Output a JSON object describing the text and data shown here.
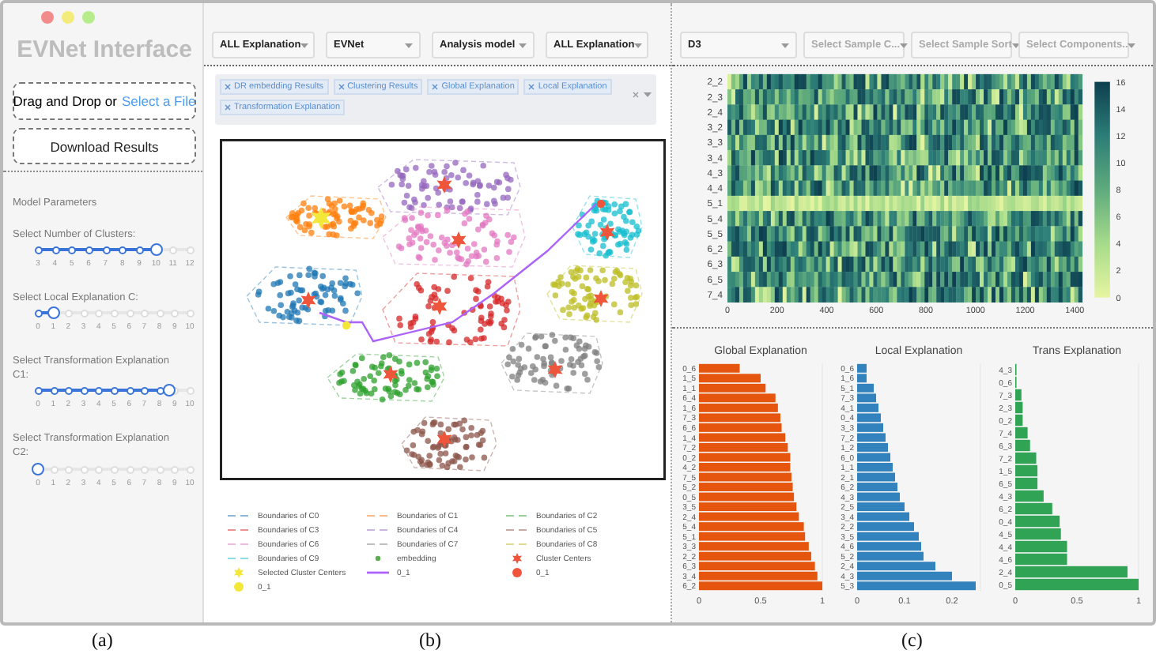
{
  "sidebar": {
    "title": "EVNet Interface",
    "upload": {
      "text": "Drag and Drop or",
      "link": "Select a File"
    },
    "download_button": "Download Results",
    "section_title": "Model Parameters",
    "sliders": [
      {
        "label": "Select Number of Clusters:",
        "level": 0.78,
        "ticks": [
          "3",
          "4",
          "5",
          "6",
          "7",
          "8",
          "9",
          "10",
          "11",
          "12"
        ]
      },
      {
        "label": "Select Local Explanation C:",
        "level": 0.1,
        "ticks": [
          "0",
          "1",
          "2",
          "3",
          "4",
          "5",
          "6",
          "7",
          "8",
          "9",
          "10"
        ]
      },
      {
        "label": "Select Transformation Explanation C1:",
        "level": 0.86,
        "ticks": [
          "0",
          "1",
          "2",
          "3",
          "4",
          "5",
          "6",
          "7",
          "8",
          "9",
          "10"
        ]
      },
      {
        "label": "Select Transformation Explanation C2:",
        "level": 0,
        "ticks": [
          "0",
          "1",
          "2",
          "3",
          "4",
          "5",
          "6",
          "7",
          "8",
          "9",
          "10"
        ]
      }
    ]
  },
  "middle": {
    "dropdowns": [
      {
        "value": "ALL Explanation"
      },
      {
        "value": "EVNet"
      },
      {
        "value": "Analysis model"
      },
      {
        "value": "ALL Explanation"
      }
    ],
    "tags": [
      "DR embedding Results",
      "Clustering Results",
      "Global Explanation",
      "Local Explanation",
      "Transformation Explanation"
    ],
    "legend": [
      {
        "kind": "dash",
        "label": "Boundaries of C0",
        "color": "#8fb8d8"
      },
      {
        "kind": "dash",
        "label": "Boundaries of C1",
        "color": "#f7b98a"
      },
      {
        "kind": "dash",
        "label": "Boundaries of C2",
        "color": "#9bd09b"
      },
      {
        "kind": "dash",
        "label": "Boundaries of C3",
        "color": "#eb9393"
      },
      {
        "kind": "dash",
        "label": "Boundaries of C4",
        "color": "#c9b6df"
      },
      {
        "kind": "dash",
        "label": "Boundaries of C5",
        "color": "#c6aaa4"
      },
      {
        "kind": "dash",
        "label": "Boundaries of C6",
        "color": "#f1bbe0"
      },
      {
        "kind": "dash",
        "label": "Boundaries of C7",
        "color": "#bfbfbf"
      },
      {
        "kind": "dash",
        "label": "Boundaries of C8",
        "color": "#dede90"
      },
      {
        "kind": "dash",
        "label": "Boundaries of C9",
        "color": "#8bdde7"
      },
      {
        "kind": "dot",
        "label": "embedding",
        "color": "#5aae4f"
      },
      {
        "kind": "star",
        "label": "Cluster Centers",
        "color": "#ef553b"
      },
      {
        "kind": "star",
        "label": "Selected Cluster Centers",
        "color": "#f3e83a"
      },
      {
        "kind": "line",
        "label": "0_1",
        "color": "#ab63fa"
      },
      {
        "kind": "dot",
        "label": "0_1",
        "color": "#ef553b"
      },
      {
        "kind": "dot",
        "label": "0_1",
        "color": "#f3e83a"
      }
    ]
  },
  "right": {
    "dropdowns": [
      {
        "value": "D3"
      },
      {
        "placeholder": "Select Sample C..."
      },
      {
        "placeholder": "Select Sample Sort"
      },
      {
        "placeholder": "Select Components.."
      }
    ],
    "heatmap": {
      "rows": [
        "2_2",
        "2_3",
        "2_4",
        "3_2",
        "3_3",
        "3_4",
        "4_3",
        "4_4",
        "5_1",
        "5_4",
        "5_5",
        "6_2",
        "6_3",
        "6_5",
        "7_4"
      ],
      "xticks": [
        "0",
        "200",
        "400",
        "600",
        "800",
        "1000",
        "1200",
        "1400"
      ],
      "scale_ticks": [
        "16",
        "14",
        "12",
        "10",
        "8",
        "6",
        "4",
        "2",
        "0"
      ]
    },
    "bar_charts": [
      {
        "chart_data": {
          "type": "bar",
          "orientation": "horizontal",
          "title": "Global Explanation",
          "categories": [
            "0_6",
            "1_5",
            "1_1",
            "6_4",
            "1_6",
            "7_3",
            "6_6",
            "1_4",
            "7_2",
            "0_2",
            "4_2",
            "7_5",
            "5_2",
            "0_5",
            "3_5",
            "2_4",
            "5_4",
            "5_1",
            "3_3",
            "2_2",
            "6_3",
            "3_4",
            "6_2"
          ],
          "series": [
            {
              "color": "#e6550d",
              "values": [
                0.33,
                0.5,
                0.54,
                0.62,
                0.64,
                0.66,
                0.67,
                0.7,
                0.72,
                0.74,
                0.74,
                0.75,
                0.76,
                0.77,
                0.79,
                0.81,
                0.85,
                0.86,
                0.89,
                0.91,
                0.94,
                0.96,
                1.0
              ]
            }
          ],
          "xlim": [
            0,
            1
          ],
          "xticks": [
            0,
            0.5,
            1
          ]
        }
      },
      {
        "chart_data": {
          "type": "bar",
          "orientation": "horizontal",
          "title": "Local Explanation",
          "categories": [
            "0_6",
            "1_6",
            "5_1",
            "7_3",
            "4_1",
            "0_4",
            "3_3",
            "7_2",
            "1_2",
            "6_0",
            "1_1",
            "2_1",
            "6_2",
            "4_3",
            "2_5",
            "3_4",
            "2_2",
            "3_5",
            "4_6",
            "5_2",
            "2_4",
            "4_3",
            "5_3"
          ],
          "series": [
            {
              "color": "#3182bd",
              "values": [
                0.02,
                0.02,
                0.035,
                0.04,
                0.045,
                0.05,
                0.055,
                0.06,
                0.065,
                0.07,
                0.075,
                0.08,
                0.085,
                0.09,
                0.1,
                0.11,
                0.12,
                0.13,
                0.135,
                0.14,
                0.165,
                0.2,
                0.25
              ]
            }
          ],
          "xlim": [
            0,
            0.26
          ],
          "xticks": [
            0,
            0.1,
            0.2
          ]
        }
      },
      {
        "chart_data": {
          "type": "bar",
          "orientation": "horizontal",
          "title": "Trans Explanation",
          "categories": [
            "4_3",
            "0_6",
            "7_3",
            "2_3",
            "0_2",
            "7_4",
            "6_3",
            "7_2",
            "1_5",
            "6_5",
            "4_3",
            "6_2",
            "0_4",
            "4_5",
            "4_4",
            "4_6",
            "2_4",
            "0_5"
          ],
          "series": [
            {
              "color": "#31a354",
              "values": [
                0.01,
                0.01,
                0.05,
                0.06,
                0.06,
                0.1,
                0.12,
                0.17,
                0.18,
                0.18,
                0.23,
                0.3,
                0.36,
                0.37,
                0.42,
                0.42,
                0.91,
                1.0
              ]
            }
          ],
          "xlim": [
            0,
            1
          ],
          "xticks": [
            0,
            0.5,
            1
          ]
        }
      }
    ]
  },
  "captions": [
    "(a)",
    "(b)",
    "(c)"
  ]
}
